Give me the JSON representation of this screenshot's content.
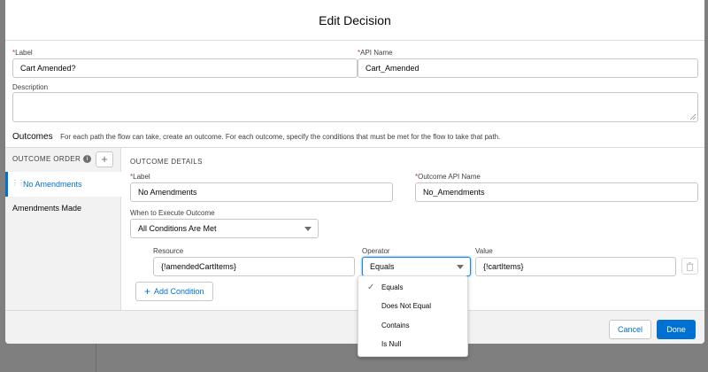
{
  "modal": {
    "title": "Edit Decision"
  },
  "form": {
    "label": {
      "title": "Label",
      "value": "Cart Amended?"
    },
    "api_name": {
      "title": "API Name",
      "value": "Cart_Amended"
    },
    "description": {
      "title": "Description",
      "value": ""
    }
  },
  "outcomes": {
    "title": "Outcomes",
    "description": "For each path the flow can take, create an outcome. For each outcome, specify the conditions that must be met for the flow to take that path.",
    "order_header": "OUTCOME ORDER",
    "items": [
      {
        "label": "No Amendments",
        "active": true
      },
      {
        "label": "Amendments Made",
        "active": false
      }
    ]
  },
  "details": {
    "header": "OUTCOME DETAILS",
    "label": {
      "title": "Label",
      "value": "No Amendments"
    },
    "api_name": {
      "title": "Outcome API Name",
      "value": "No_Amendments"
    },
    "when_execute": {
      "title": "When to Execute Outcome",
      "value": "All Conditions Are Met"
    },
    "condition": {
      "resource_title": "Resource",
      "resource_value": "{!amendedCartItems}",
      "operator_title": "Operator",
      "operator_value": "Equals",
      "value_title": "Value",
      "value_value": "{!cartItems}"
    },
    "add_condition_label": "Add Condition"
  },
  "operator_dropdown": {
    "options": [
      "Equals",
      "Does Not Equal",
      "Contains",
      "Is Null"
    ],
    "selected": "Equals"
  },
  "footer": {
    "cancel_label": "Cancel",
    "done_label": "Done"
  },
  "icons": {
    "info": "info-icon",
    "add": "plus-icon",
    "drag": "drag-handle-icon",
    "trash": "trash-icon",
    "check": "check-icon",
    "caret": "chevron-down-icon"
  },
  "colors": {
    "brand": "#0070d2",
    "required": "#c23934",
    "panel_bg": "#f3f2f2"
  }
}
